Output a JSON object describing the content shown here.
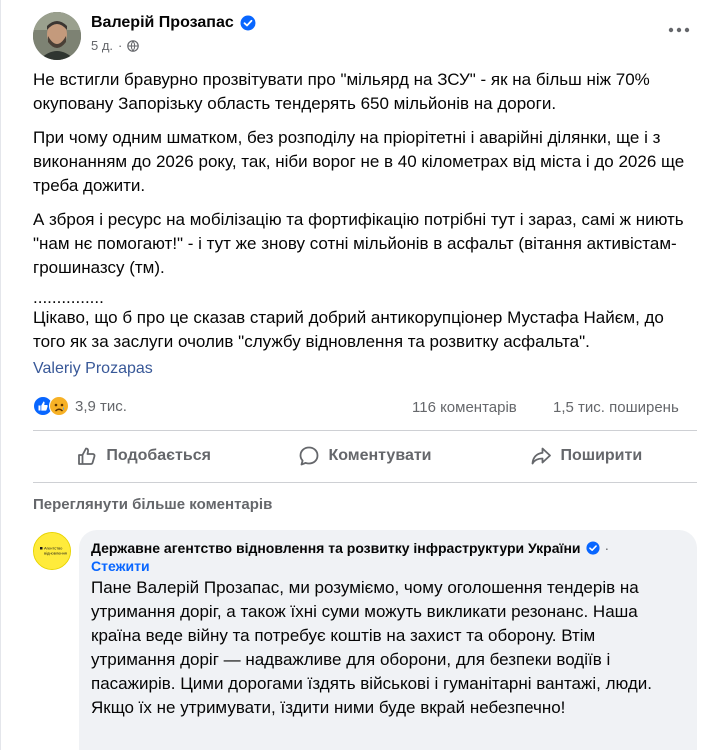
{
  "post": {
    "author": "Валерій Прозапас",
    "time": "5 д.",
    "paragraphs": [
      "Не встигли бравурно прозвітувати про \"мільярд на ЗСУ\" - як на більш ніж 70% окуповану Запорізьку область тендерять 650 мільйонів на дороги.",
      "При чому одним шматком, без розподілу на пріорітетні і аварійні ділянки, ще і з виконанням до 2026 року, так, ніби ворог не в 40 кілометрах від міста і до 2026 ще треба дожити.",
      "А зброя і ресурс на мобілізацію та фортифікацію потрібні тут і зараз, самі ж ниють \"нам нє помогают!\" - і тут же знову сотні мільйонів в асфальт (вітання активістам-грошиназсу (тм).",
      "...............",
      "Цікаво, що б про це сказав старий добрий антикорупціонер Мустафа Найєм, до того як за заслуги очолив \"службу відновлення та розвитку асфальта\"."
    ],
    "link": "Valeriy Prozapas",
    "reactions_count": "3,9 тис.",
    "comments_count": "116 коментарів",
    "shares_count": "1,5 тис. поширень"
  },
  "actions": {
    "like": "Подобається",
    "comment": "Коментувати",
    "share": "Поширити"
  },
  "see_more_comments": "Переглянути більше коментарів",
  "comment": {
    "author": "Державне агентство відновлення та розвитку інфраструктури України",
    "separator": "·",
    "follow": "Стежити",
    "text": "Пане Валерій Прозапас, ми розуміємо, чому оголошення тендерів на утримання доріг, а також їхні суми можуть викликати резонанс. Наша країна веде війну та потребує коштів на захист та оборону. Втім утримання доріг — надважливе для оборони, для безпеки водіїв і пасажирів. Цими дорогами їздять військові і гуманітарні вантажі, люди. Якщо їх не утримувати, їздити ними буде вкрай небезпечно!",
    "avatar_text": "Агентство відновлення"
  },
  "colors": {
    "verified": "#0866ff",
    "link": "#385898",
    "like": "#0866ff",
    "sad": "#f7b125",
    "avatar_yellow": "#ffeb3b"
  },
  "icons": [
    "verified-badge-icon",
    "globe-icon",
    "more-options-icon",
    "like-reaction-icon",
    "sad-reaction-icon",
    "thumbs-up-icon",
    "comment-bubble-icon",
    "share-arrow-icon"
  ]
}
